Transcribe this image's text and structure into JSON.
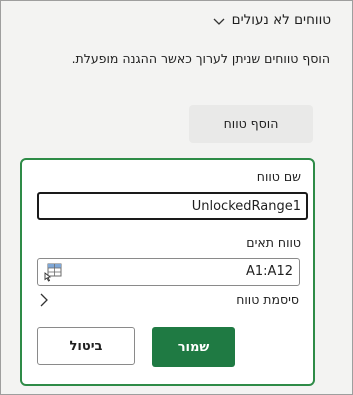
{
  "section": {
    "title": "טווחים לא נעולים",
    "description": "הוסף טווחים שניתן לערוך כאשר ההגנה מופעלת.",
    "add_range_label": "הוסף טווח"
  },
  "form": {
    "range_name_label": "שם טווח",
    "range_name_value": "UnlockedRange1",
    "cell_range_label": "טווח תאים",
    "cell_range_value": "A1:A12",
    "range_password_label": "סיסמת טווח",
    "save_label": "שמור",
    "cancel_label": "ביטול"
  },
  "colors": {
    "accent": "#1f7a43",
    "card_border": "#2e8b47",
    "panel_bg": "#f3f3f2"
  },
  "icons": [
    "chevron-down-icon",
    "range-selector-icon",
    "chevron-right-icon"
  ]
}
